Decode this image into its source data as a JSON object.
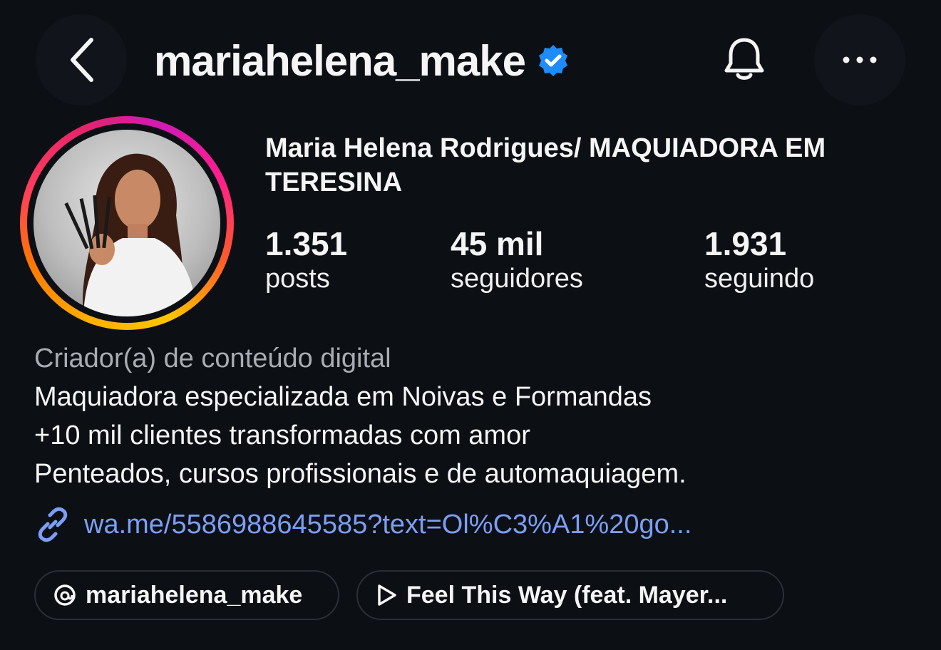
{
  "header": {
    "back_icon": "chevron-left-icon",
    "username": "mariahelena_make",
    "verified_icon": "verified-badge-icon",
    "bell_icon": "bell-icon",
    "more_icon": "more-horizontal-icon"
  },
  "profile": {
    "display_name": "Maria Helena Rodrigues/ MAQUIADORA EM TERESINA",
    "stats": [
      {
        "value": "1.351",
        "label": "posts"
      },
      {
        "value": "45 mil",
        "label": "seguidores"
      },
      {
        "value": "1.931",
        "label": "seguindo"
      }
    ],
    "category": "Criador(a) de conteúdo digital",
    "bio": [
      "Maquiadora especializada em Noivas e Formandas",
      "+10 mil clientes transformadas com amor",
      "Penteados, cursos profissionais e de automaquiagem."
    ],
    "link": "wa.me/5586988645585?text=Ol%C3%A1%20go..."
  },
  "chips": {
    "threads": "mariahelena_make",
    "music": "Feel This Way (feat. Mayer..."
  },
  "colors": {
    "background": "#0c0f14",
    "link": "#7b9ff5",
    "verified": "#1d8cf8",
    "secondary_text": "#a8acb3"
  }
}
